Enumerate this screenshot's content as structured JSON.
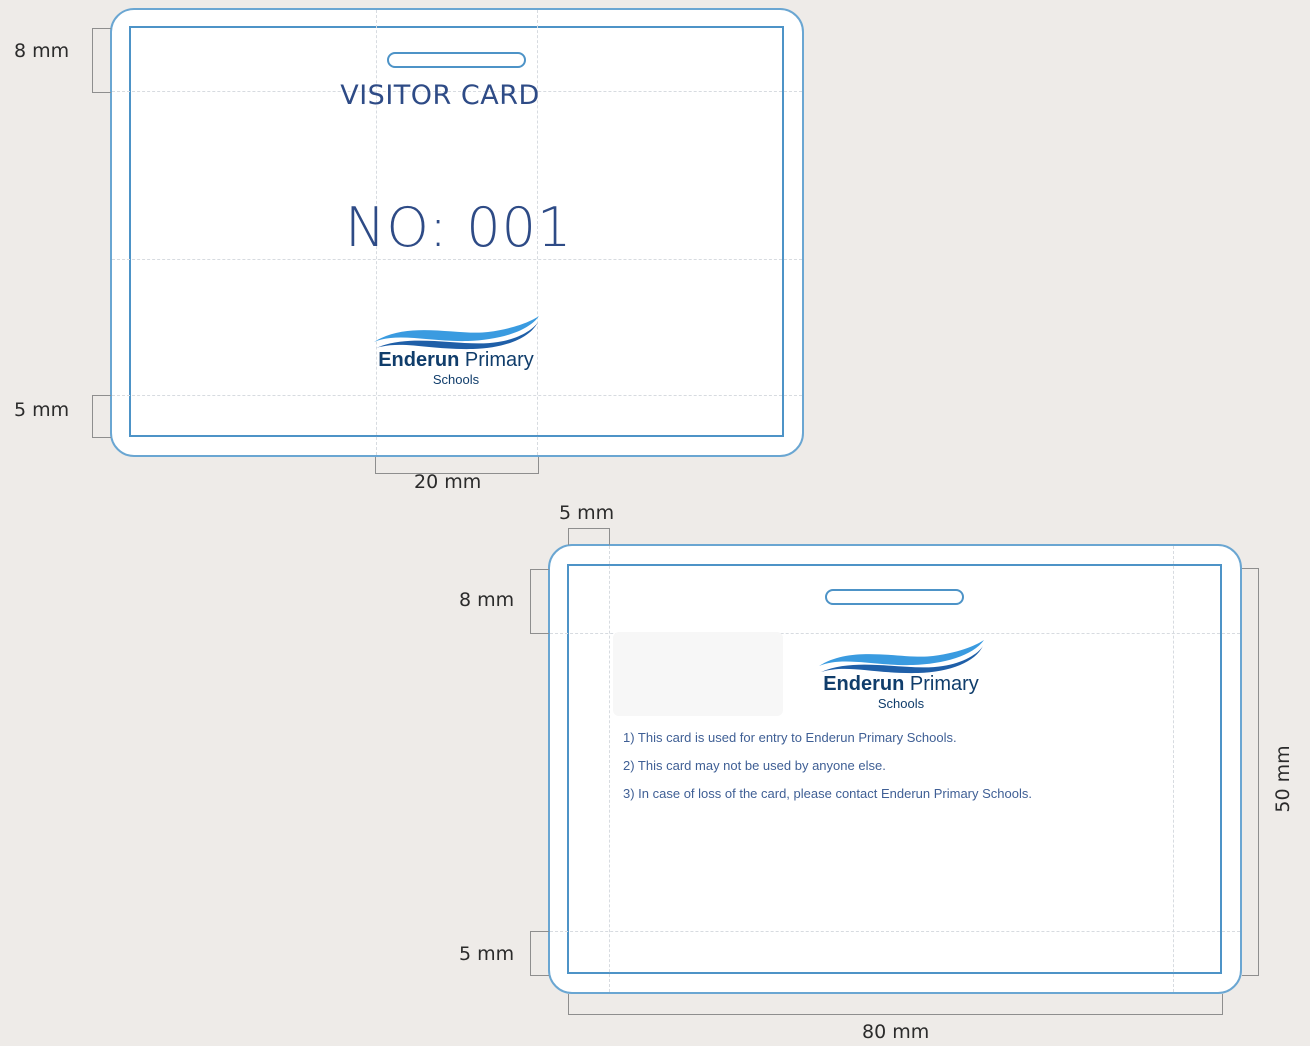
{
  "front": {
    "title": "VISITOR CARD",
    "number": "NO: 001",
    "logo": {
      "name_bold": "Enderun",
      "name_regular": "Primary",
      "sub": "Schools"
    }
  },
  "back": {
    "logo": {
      "name_bold": "Enderun",
      "name_regular": "Primary",
      "sub": "Schools"
    },
    "rules": [
      "1) This card is used for entry to Enderun Primary Schools.",
      "2) This card may not be used by anyone else.",
      "3) In case of loss of the card, please contact Enderun Primary Schools."
    ]
  },
  "dimensions": {
    "front_top_margin": "8 mm",
    "front_bottom_margin": "5 mm",
    "front_slot_width": "20 mm",
    "back_left_margin": "5 mm",
    "back_top_margin": "8 mm",
    "back_bottom_margin": "5 mm",
    "back_height": "50 mm",
    "back_width": "80 mm"
  },
  "colors": {
    "text_blue": "#2e4b86",
    "line_blue": "#4d93c7",
    "logo_navy": "#103d6b",
    "wave_light": "#3a9be0",
    "wave_dark": "#1f5fa8"
  }
}
